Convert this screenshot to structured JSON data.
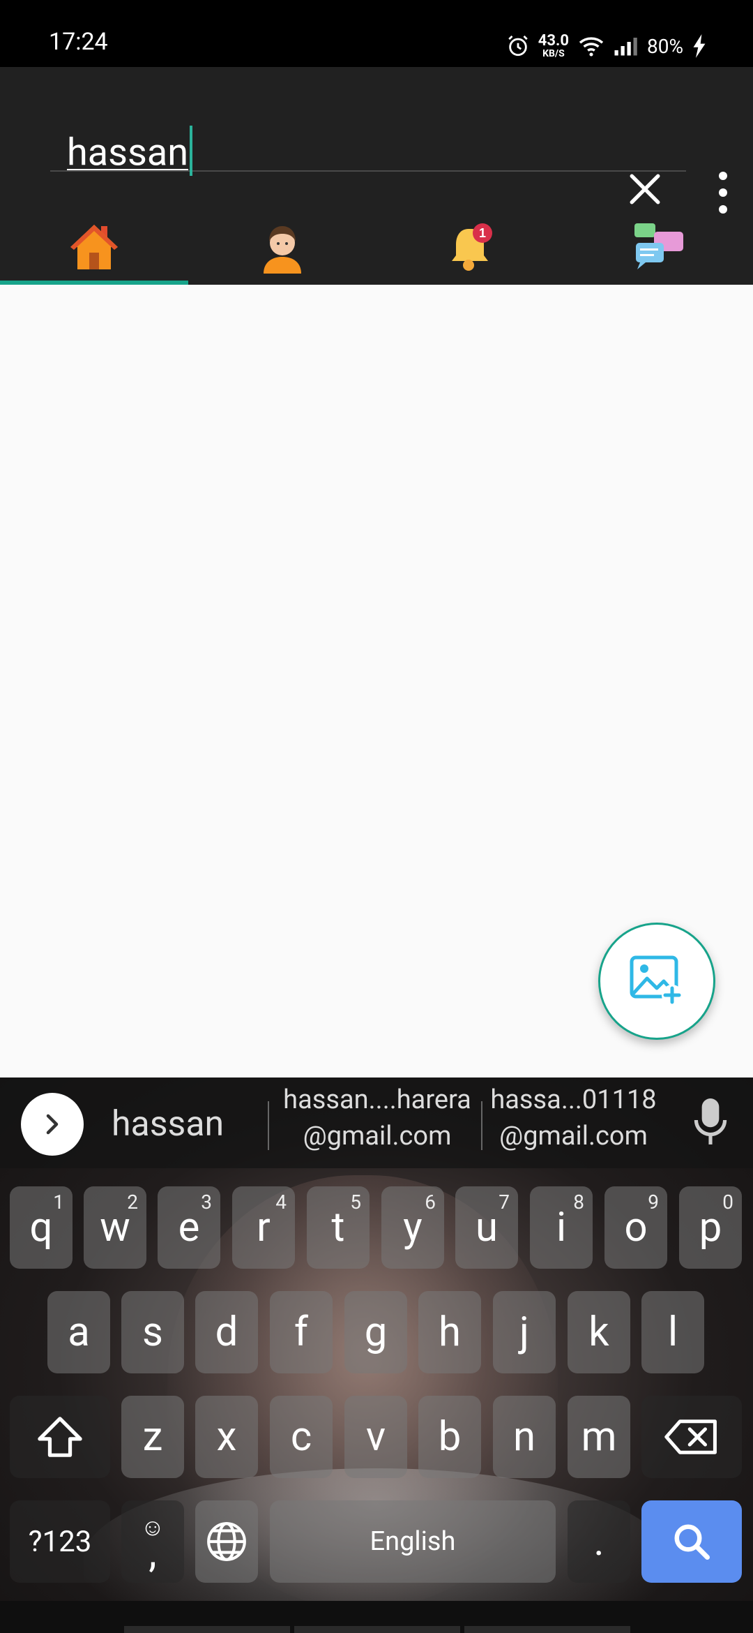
{
  "status_bar": {
    "time": "17:24",
    "net_speed_value": "43.0",
    "net_speed_unit": "KB/S",
    "battery": "80%"
  },
  "search": {
    "query": "hassan"
  },
  "tabs": [
    {
      "name": "home",
      "icon": "home-icon",
      "active": true
    },
    {
      "name": "profile",
      "icon": "person-avatar-icon",
      "active": false
    },
    {
      "name": "notifications",
      "icon": "bell-icon",
      "badge": "1",
      "active": false
    },
    {
      "name": "messages",
      "icon": "chat-bubbles-icon",
      "active": false
    }
  ],
  "fab": {
    "icon": "add-image-icon"
  },
  "keyboard": {
    "suggestion_word": "hassan",
    "email_suggestions": [
      {
        "line1": "hassan....harera",
        "line2": "@gmail.com"
      },
      {
        "line1": "hassa...01118",
        "line2": "@gmail.com"
      }
    ],
    "row1": [
      {
        "key": "q",
        "hint": "1"
      },
      {
        "key": "w",
        "hint": "2"
      },
      {
        "key": "e",
        "hint": "3"
      },
      {
        "key": "r",
        "hint": "4"
      },
      {
        "key": "t",
        "hint": "5"
      },
      {
        "key": "y",
        "hint": "6"
      },
      {
        "key": "u",
        "hint": "7"
      },
      {
        "key": "i",
        "hint": "8"
      },
      {
        "key": "o",
        "hint": "9"
      },
      {
        "key": "p",
        "hint": "0"
      }
    ],
    "row2": [
      "a",
      "s",
      "d",
      "f",
      "g",
      "h",
      "j",
      "k",
      "l"
    ],
    "row3": [
      "z",
      "x",
      "c",
      "v",
      "b",
      "n",
      "m"
    ],
    "symbols_key": "?123",
    "comma_key": ",",
    "space_label": "English",
    "period_key": "."
  },
  "colors": {
    "accent": "#17a38a",
    "app_bar": "#212121",
    "content_bg": "#fafafa",
    "search_key": "#5b8def"
  }
}
